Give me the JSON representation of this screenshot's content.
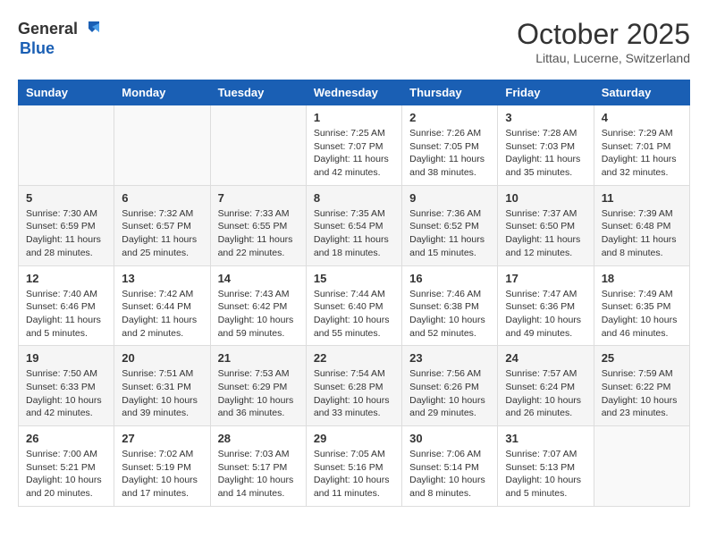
{
  "header": {
    "logo_general": "General",
    "logo_blue": "Blue",
    "month": "October 2025",
    "location": "Littau, Lucerne, Switzerland"
  },
  "days_of_week": [
    "Sunday",
    "Monday",
    "Tuesday",
    "Wednesday",
    "Thursday",
    "Friday",
    "Saturday"
  ],
  "weeks": [
    [
      {
        "day": "",
        "info": ""
      },
      {
        "day": "",
        "info": ""
      },
      {
        "day": "",
        "info": ""
      },
      {
        "day": "1",
        "info": "Sunrise: 7:25 AM\nSunset: 7:07 PM\nDaylight: 11 hours\nand 42 minutes."
      },
      {
        "day": "2",
        "info": "Sunrise: 7:26 AM\nSunset: 7:05 PM\nDaylight: 11 hours\nand 38 minutes."
      },
      {
        "day": "3",
        "info": "Sunrise: 7:28 AM\nSunset: 7:03 PM\nDaylight: 11 hours\nand 35 minutes."
      },
      {
        "day": "4",
        "info": "Sunrise: 7:29 AM\nSunset: 7:01 PM\nDaylight: 11 hours\nand 32 minutes."
      }
    ],
    [
      {
        "day": "5",
        "info": "Sunrise: 7:30 AM\nSunset: 6:59 PM\nDaylight: 11 hours\nand 28 minutes."
      },
      {
        "day": "6",
        "info": "Sunrise: 7:32 AM\nSunset: 6:57 PM\nDaylight: 11 hours\nand 25 minutes."
      },
      {
        "day": "7",
        "info": "Sunrise: 7:33 AM\nSunset: 6:55 PM\nDaylight: 11 hours\nand 22 minutes."
      },
      {
        "day": "8",
        "info": "Sunrise: 7:35 AM\nSunset: 6:54 PM\nDaylight: 11 hours\nand 18 minutes."
      },
      {
        "day": "9",
        "info": "Sunrise: 7:36 AM\nSunset: 6:52 PM\nDaylight: 11 hours\nand 15 minutes."
      },
      {
        "day": "10",
        "info": "Sunrise: 7:37 AM\nSunset: 6:50 PM\nDaylight: 11 hours\nand 12 minutes."
      },
      {
        "day": "11",
        "info": "Sunrise: 7:39 AM\nSunset: 6:48 PM\nDaylight: 11 hours\nand 8 minutes."
      }
    ],
    [
      {
        "day": "12",
        "info": "Sunrise: 7:40 AM\nSunset: 6:46 PM\nDaylight: 11 hours\nand 5 minutes."
      },
      {
        "day": "13",
        "info": "Sunrise: 7:42 AM\nSunset: 6:44 PM\nDaylight: 11 hours\nand 2 minutes."
      },
      {
        "day": "14",
        "info": "Sunrise: 7:43 AM\nSunset: 6:42 PM\nDaylight: 10 hours\nand 59 minutes."
      },
      {
        "day": "15",
        "info": "Sunrise: 7:44 AM\nSunset: 6:40 PM\nDaylight: 10 hours\nand 55 minutes."
      },
      {
        "day": "16",
        "info": "Sunrise: 7:46 AM\nSunset: 6:38 PM\nDaylight: 10 hours\nand 52 minutes."
      },
      {
        "day": "17",
        "info": "Sunrise: 7:47 AM\nSunset: 6:36 PM\nDaylight: 10 hours\nand 49 minutes."
      },
      {
        "day": "18",
        "info": "Sunrise: 7:49 AM\nSunset: 6:35 PM\nDaylight: 10 hours\nand 46 minutes."
      }
    ],
    [
      {
        "day": "19",
        "info": "Sunrise: 7:50 AM\nSunset: 6:33 PM\nDaylight: 10 hours\nand 42 minutes."
      },
      {
        "day": "20",
        "info": "Sunrise: 7:51 AM\nSunset: 6:31 PM\nDaylight: 10 hours\nand 39 minutes."
      },
      {
        "day": "21",
        "info": "Sunrise: 7:53 AM\nSunset: 6:29 PM\nDaylight: 10 hours\nand 36 minutes."
      },
      {
        "day": "22",
        "info": "Sunrise: 7:54 AM\nSunset: 6:28 PM\nDaylight: 10 hours\nand 33 minutes."
      },
      {
        "day": "23",
        "info": "Sunrise: 7:56 AM\nSunset: 6:26 PM\nDaylight: 10 hours\nand 29 minutes."
      },
      {
        "day": "24",
        "info": "Sunrise: 7:57 AM\nSunset: 6:24 PM\nDaylight: 10 hours\nand 26 minutes."
      },
      {
        "day": "25",
        "info": "Sunrise: 7:59 AM\nSunset: 6:22 PM\nDaylight: 10 hours\nand 23 minutes."
      }
    ],
    [
      {
        "day": "26",
        "info": "Sunrise: 7:00 AM\nSunset: 5:21 PM\nDaylight: 10 hours\nand 20 minutes."
      },
      {
        "day": "27",
        "info": "Sunrise: 7:02 AM\nSunset: 5:19 PM\nDaylight: 10 hours\nand 17 minutes."
      },
      {
        "day": "28",
        "info": "Sunrise: 7:03 AM\nSunset: 5:17 PM\nDaylight: 10 hours\nand 14 minutes."
      },
      {
        "day": "29",
        "info": "Sunrise: 7:05 AM\nSunset: 5:16 PM\nDaylight: 10 hours\nand 11 minutes."
      },
      {
        "day": "30",
        "info": "Sunrise: 7:06 AM\nSunset: 5:14 PM\nDaylight: 10 hours\nand 8 minutes."
      },
      {
        "day": "31",
        "info": "Sunrise: 7:07 AM\nSunset: 5:13 PM\nDaylight: 10 hours\nand 5 minutes."
      },
      {
        "day": "",
        "info": ""
      }
    ]
  ]
}
